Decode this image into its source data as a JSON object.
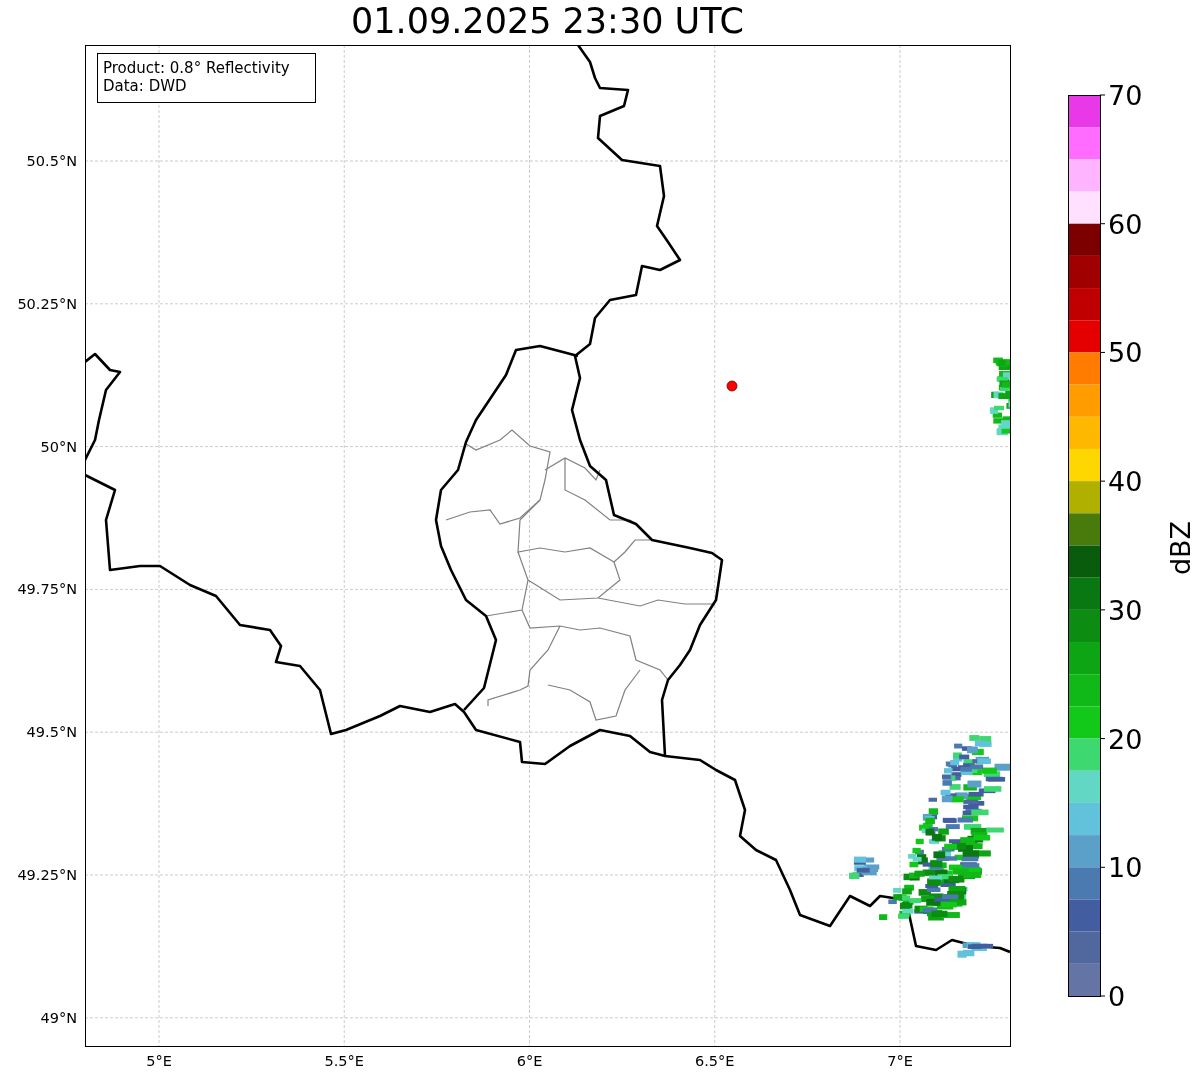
{
  "title": "01.09.2025 23:30 UTC",
  "info_box": {
    "lines": [
      "Product: 0.8° Reflectivity",
      "Data: DWD"
    ]
  },
  "map": {
    "yticks": [
      "50.5°N",
      "50.25°N",
      "50°N",
      "49.75°N",
      "49.5°N",
      "49.25°N",
      "49°N"
    ],
    "xticks": [
      "5°E",
      "5.5°E",
      "6°E",
      "6.5°E",
      "7°E"
    ]
  },
  "colorbar": {
    "label": "dBZ",
    "ticks": [
      "70",
      "60",
      "50",
      "40",
      "30",
      "20",
      "10",
      "0"
    ],
    "bins": [
      {
        "color": "#e838e8"
      },
      {
        "color": "#ff6cff"
      },
      {
        "color": "#ffb4ff"
      },
      {
        "color": "#ffe0ff"
      },
      {
        "color": "#7c0000"
      },
      {
        "color": "#a00000"
      },
      {
        "color": "#c00000"
      },
      {
        "color": "#e40000"
      },
      {
        "color": "#ff7c00"
      },
      {
        "color": "#ff9c00"
      },
      {
        "color": "#ffb800"
      },
      {
        "color": "#ffd700"
      },
      {
        "color": "#b0b000"
      },
      {
        "color": "#487a0c"
      },
      {
        "color": "#085c0c"
      },
      {
        "color": "#0a7812"
      },
      {
        "color": "#0c8c10"
      },
      {
        "color": "#0ea514"
      },
      {
        "color": "#10b818"
      },
      {
        "color": "#12c818"
      },
      {
        "color": "#3ed870"
      },
      {
        "color": "#62d8c4"
      },
      {
        "color": "#62c2dc"
      },
      {
        "color": "#5aa0c8"
      },
      {
        "color": "#4a7ab0"
      },
      {
        "color": "#425ea0"
      },
      {
        "color": "#51689e"
      },
      {
        "color": "#6474a4"
      }
    ]
  }
}
